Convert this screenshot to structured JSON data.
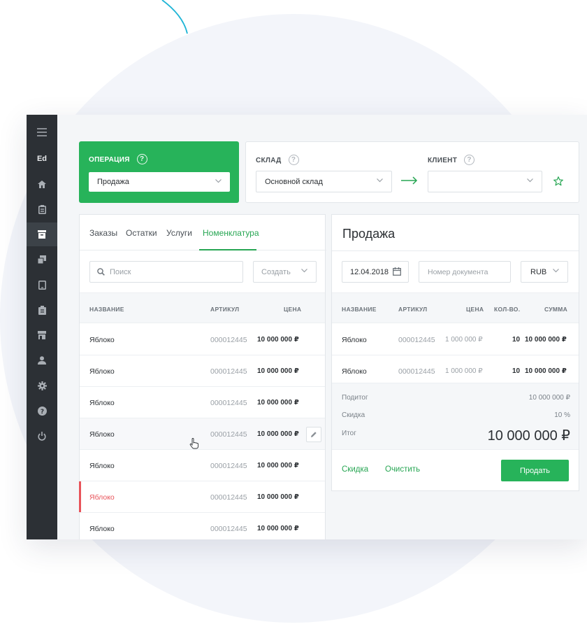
{
  "sidebar": {
    "items": [
      {
        "icon": "menu-icon",
        "label": ""
      },
      {
        "icon": "",
        "label": "Ed"
      },
      {
        "icon": "home-icon",
        "label": ""
      },
      {
        "icon": "clipboard-icon",
        "label": ""
      },
      {
        "icon": "archive-icon",
        "label": ""
      },
      {
        "icon": "copy-icon",
        "label": ""
      },
      {
        "icon": "tablet-icon",
        "label": ""
      },
      {
        "icon": "clipboard-list-icon",
        "label": ""
      },
      {
        "icon": "store-icon",
        "label": ""
      },
      {
        "icon": "user-icon",
        "label": ""
      },
      {
        "icon": "gear-icon",
        "label": ""
      },
      {
        "icon": "help-icon",
        "label": ""
      },
      {
        "icon": "power-icon",
        "label": ""
      }
    ]
  },
  "operation": {
    "title": "ОПЕРАЦИЯ",
    "value": "Продажа"
  },
  "warehouse": {
    "title": "СКЛАД",
    "value": "Основной склад"
  },
  "client": {
    "title": "КЛИЕНТ",
    "value": ""
  },
  "left": {
    "tabs": [
      "Заказы",
      "Остатки",
      "Услуги",
      "Номенклатура"
    ],
    "active_tab": "Номенклатура",
    "search_placeholder": "Поиск",
    "create_label": "Создать",
    "columns": [
      "НАЗВАНИЕ",
      "АРТИКУЛ",
      "ЦЕНА"
    ],
    "rows": [
      {
        "name": "Яблоко",
        "sku": "000012445",
        "price": "10 000 000 ₽"
      },
      {
        "name": "Яблоко",
        "sku": "000012445",
        "price": "10 000 000 ₽"
      },
      {
        "name": "Яблоко",
        "sku": "000012445",
        "price": "10 000 000 ₽"
      },
      {
        "name": "Яблоко",
        "sku": "000012445",
        "price": "10 000 000 ₽"
      },
      {
        "name": "Яблоко",
        "sku": "000012445",
        "price": "10 000 000 ₽"
      },
      {
        "name": "Яблоко",
        "sku": "000012445",
        "price": "10 000 000 ₽"
      },
      {
        "name": "Яблоко",
        "sku": "000012445",
        "price": "10 000 000 ₽"
      }
    ]
  },
  "right": {
    "title": "Продажа",
    "date": "12.04.2018",
    "doc_placeholder": "Номер документа",
    "currency": "RUB",
    "columns": [
      "НАЗВАНИЕ",
      "АРТИКУЛ",
      "ЦЕНА",
      "КОЛ-ВО.",
      "СУММА"
    ],
    "rows": [
      {
        "name": "Яблоко",
        "sku": "000012445",
        "price": "1 000 000 ₽",
        "qty": "10",
        "sum": "10 000 000 ₽"
      },
      {
        "name": "Яблоко",
        "sku": "000012445",
        "price": "1 000 000 ₽",
        "qty": "10",
        "sum": "10 000 000 ₽"
      }
    ],
    "subtotal_label": "Подитог",
    "subtotal_value": "10 000 000 ₽",
    "discount_label": "Скидка",
    "discount_value": "10 %",
    "total_label": "Итог",
    "total_value": "10 000 000 ₽",
    "discount_link": "Скидка",
    "clear_link": "Очистить",
    "sell_label": "Продать"
  },
  "colors": {
    "accent": "#27b35a",
    "sidebar": "#2c3035",
    "error": "#e8535a"
  }
}
